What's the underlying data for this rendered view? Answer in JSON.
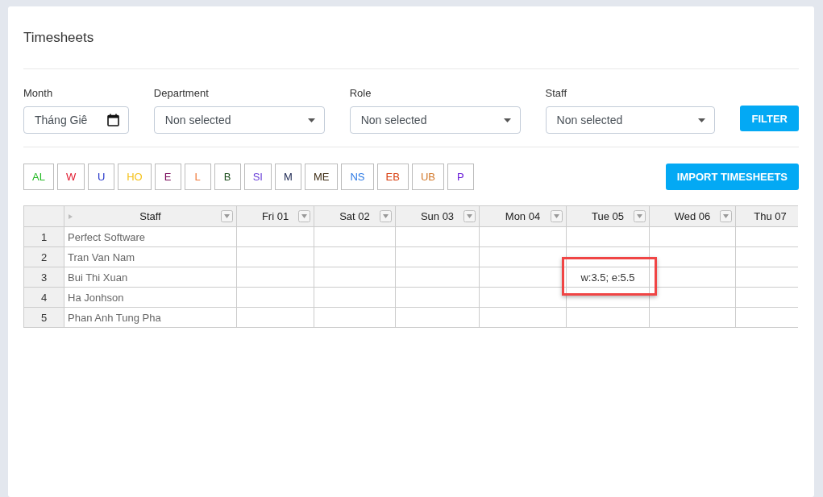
{
  "title": "Timesheets",
  "filters": [
    {
      "kind": "date",
      "label": "Month",
      "value": "Tháng Giê"
    },
    {
      "kind": "select",
      "label": "Department",
      "value": "Non selected"
    },
    {
      "kind": "select",
      "label": "Role",
      "value": "Non selected"
    },
    {
      "kind": "select",
      "label": "Staff",
      "value": "Non selected"
    }
  ],
  "filter_button": "FILTER",
  "codes": [
    {
      "label": "AL",
      "color": "#22b822"
    },
    {
      "label": "W",
      "color": "#e0182d"
    },
    {
      "label": "U",
      "color": "#2233c8"
    },
    {
      "label": "HO",
      "color": "#f5c21b"
    },
    {
      "label": "E",
      "color": "#7a0a5a"
    },
    {
      "label": "L",
      "color": "#f07a3a"
    },
    {
      "label": "B",
      "color": "#1b4d1b"
    },
    {
      "label": "SI",
      "color": "#6a3fd8"
    },
    {
      "label": "M",
      "color": "#1a2550"
    },
    {
      "label": "ME",
      "color": "#3d2b12"
    },
    {
      "label": "NS",
      "color": "#2a78e4"
    },
    {
      "label": "EB",
      "color": "#d83c0c"
    },
    {
      "label": "UB",
      "color": "#d2782a"
    },
    {
      "label": "P",
      "color": "#6a1bd8"
    }
  ],
  "import_button": "IMPORT TIMESHEETS",
  "table": {
    "columns": [
      "Staff",
      "Fri 01",
      "Sat 02",
      "Sun 03",
      "Mon 04",
      "Tue 05",
      "Wed 06",
      "Thu 07"
    ],
    "rows": [
      {
        "number": "1",
        "highlighted": false,
        "cells": [
          "Perfect Software",
          "",
          "",
          "",
          "",
          "",
          "",
          ""
        ]
      },
      {
        "number": "2",
        "highlighted": false,
        "cells": [
          "Tran Van Nam",
          "",
          "",
          "",
          "",
          "",
          "",
          ""
        ]
      },
      {
        "number": "3",
        "highlighted": true,
        "cells": [
          "Bui Thi Xuan",
          "",
          "",
          "",
          "",
          "w:3.5; e:5.5",
          "",
          ""
        ]
      },
      {
        "number": "4",
        "highlighted": false,
        "cells": [
          "Ha Jonhson",
          "",
          "",
          "",
          "",
          "",
          "",
          ""
        ]
      },
      {
        "number": "5",
        "highlighted": false,
        "cells": [
          "Phan Anh Tung Pha",
          "",
          "",
          "",
          "",
          "",
          "",
          ""
        ]
      }
    ]
  }
}
